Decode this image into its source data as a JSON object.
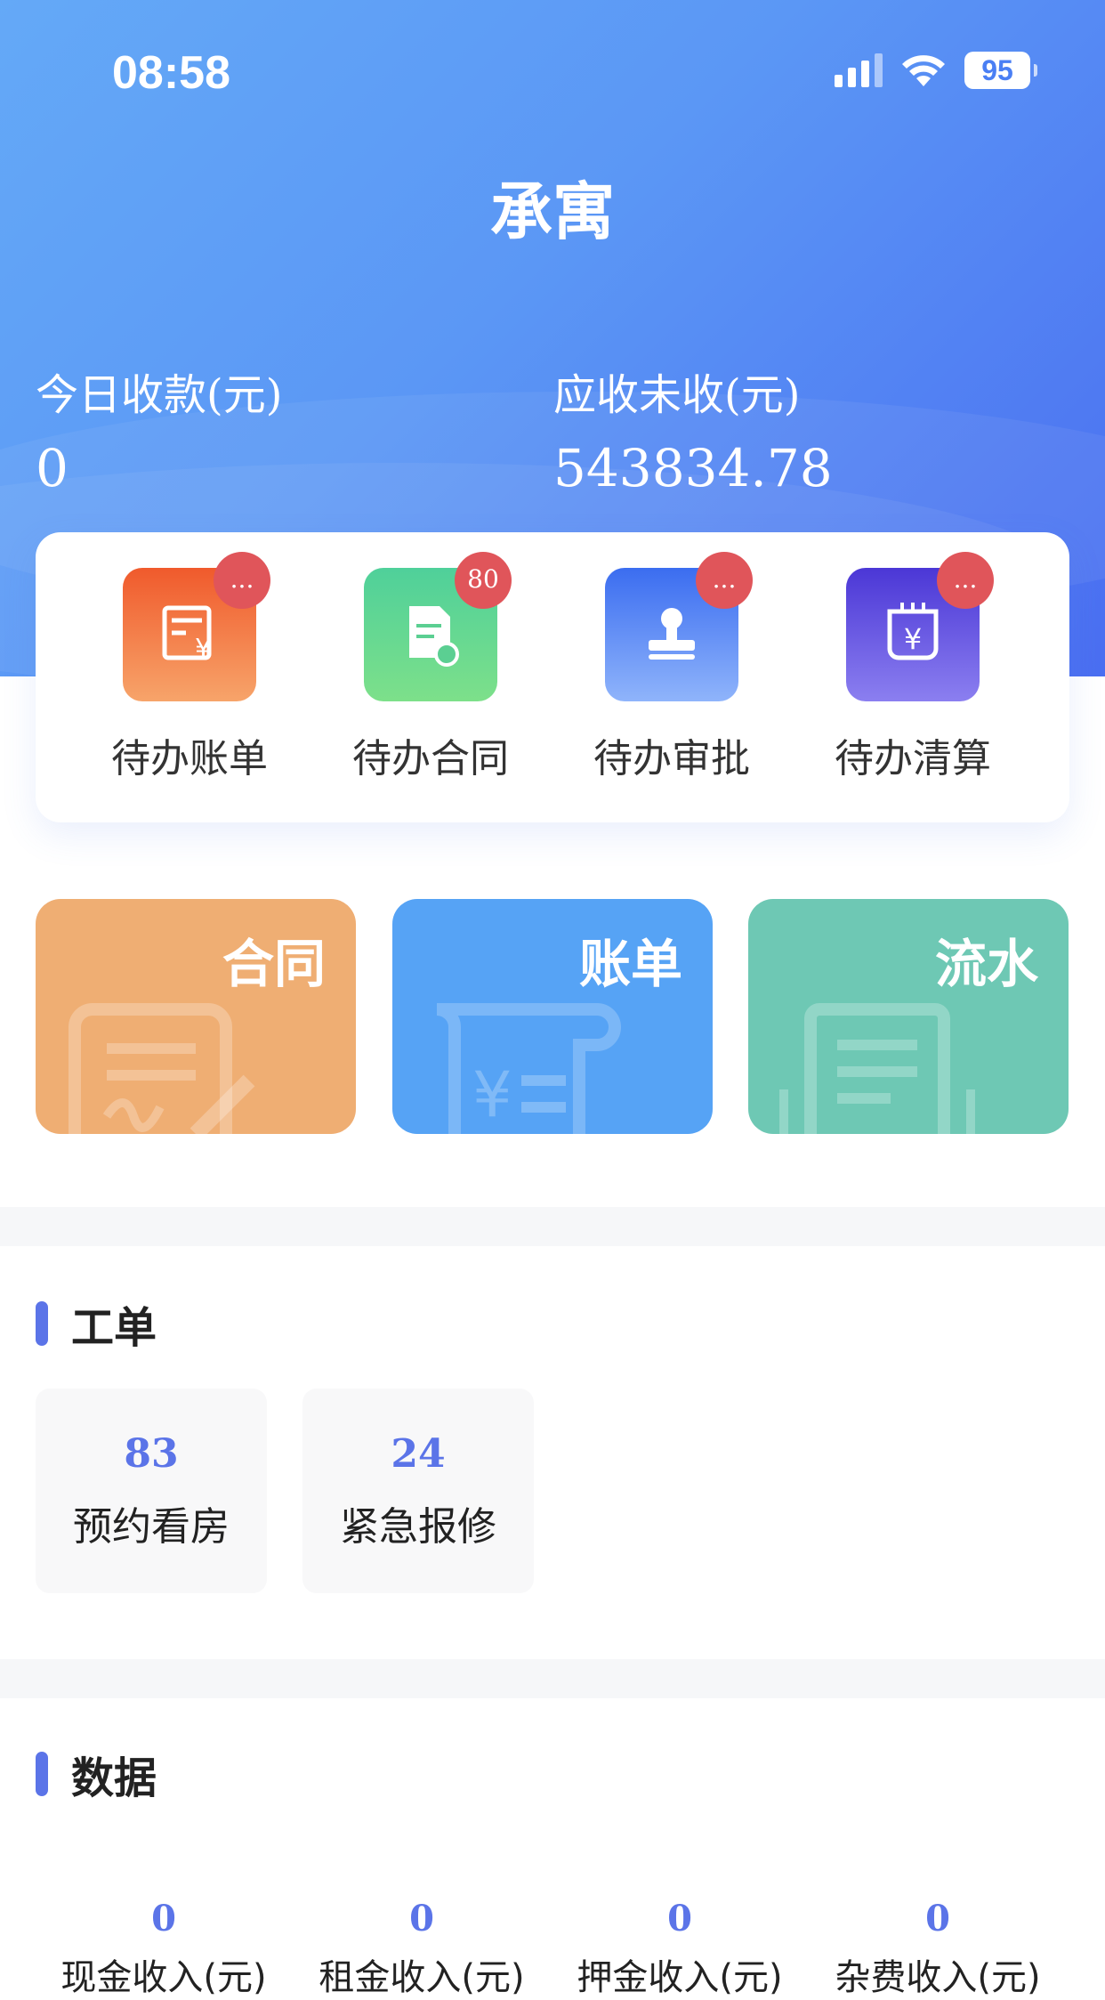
{
  "status_bar": {
    "time": "08:58",
    "battery": "95"
  },
  "app_title": "承寓",
  "stats": [
    {
      "label": "今日收款(元)",
      "value": "0"
    },
    {
      "label": "应收未收(元)",
      "value": "543834.78"
    }
  ],
  "todos": [
    {
      "label": "待办账单",
      "badge": "...",
      "icon": "bill-icon"
    },
    {
      "label": "待办合同",
      "badge": "80",
      "icon": "contract-icon"
    },
    {
      "label": "待办审批",
      "badge": "...",
      "icon": "stamp-icon"
    },
    {
      "label": "待办清算",
      "badge": "...",
      "icon": "settlement-icon"
    }
  ],
  "quick_cards": [
    {
      "label": "合同",
      "color": "#efae73",
      "icon": "contract-sign-icon"
    },
    {
      "label": "账单",
      "color": "#56a3f5",
      "icon": "bill-scroll-icon"
    },
    {
      "label": "流水",
      "color": "#6ec8b4",
      "icon": "ledger-icon"
    }
  ],
  "work_orders": {
    "title": "工单",
    "items": [
      {
        "value": "83",
        "label": "预约看房"
      },
      {
        "value": "24",
        "label": "紧急报修"
      }
    ]
  },
  "data_section": {
    "title": "数据",
    "items": [
      {
        "value": "0",
        "label": "现金收入(元)"
      },
      {
        "value": "0",
        "label": "租金收入(元)"
      },
      {
        "value": "0",
        "label": "押金收入(元)"
      },
      {
        "value": "0",
        "label": "杂费收入(元)"
      }
    ]
  },
  "colors": {
    "accent": "#5b74e8",
    "badge": "#e0555a"
  }
}
